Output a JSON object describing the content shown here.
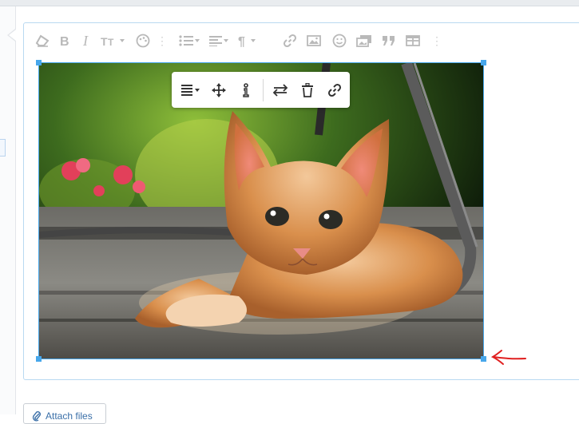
{
  "editor": {
    "toolbar": [
      {
        "icon": "eraser-icon"
      },
      {
        "icon": "bold-icon"
      },
      {
        "icon": "italic-icon"
      },
      {
        "icon": "text-size-icon"
      },
      {
        "icon": "palette-icon"
      },
      {
        "icon": "more-vertical-icon"
      },
      {
        "icon": "list-icon"
      },
      {
        "icon": "align-icon"
      },
      {
        "icon": "paragraph-icon"
      },
      {
        "icon": "link-icon"
      },
      {
        "icon": "image-icon"
      },
      {
        "icon": "smiley-icon"
      },
      {
        "icon": "media-icon"
      },
      {
        "icon": "quote-icon"
      },
      {
        "icon": "table-icon"
      },
      {
        "icon": "more-vertical-icon"
      }
    ]
  },
  "image_toolbar": {
    "buttons": [
      {
        "icon": "align-dropdown-icon"
      },
      {
        "icon": "move-icon"
      },
      {
        "icon": "alt-text-icon"
      },
      {
        "icon": "replace-icon"
      },
      {
        "icon": "trash-icon"
      },
      {
        "icon": "link-icon"
      }
    ]
  },
  "image": {
    "subject": "orange kitten"
  },
  "annotation": {
    "icon": "red-arrow-pointing-left"
  },
  "attach": {
    "label": "Attach files"
  }
}
